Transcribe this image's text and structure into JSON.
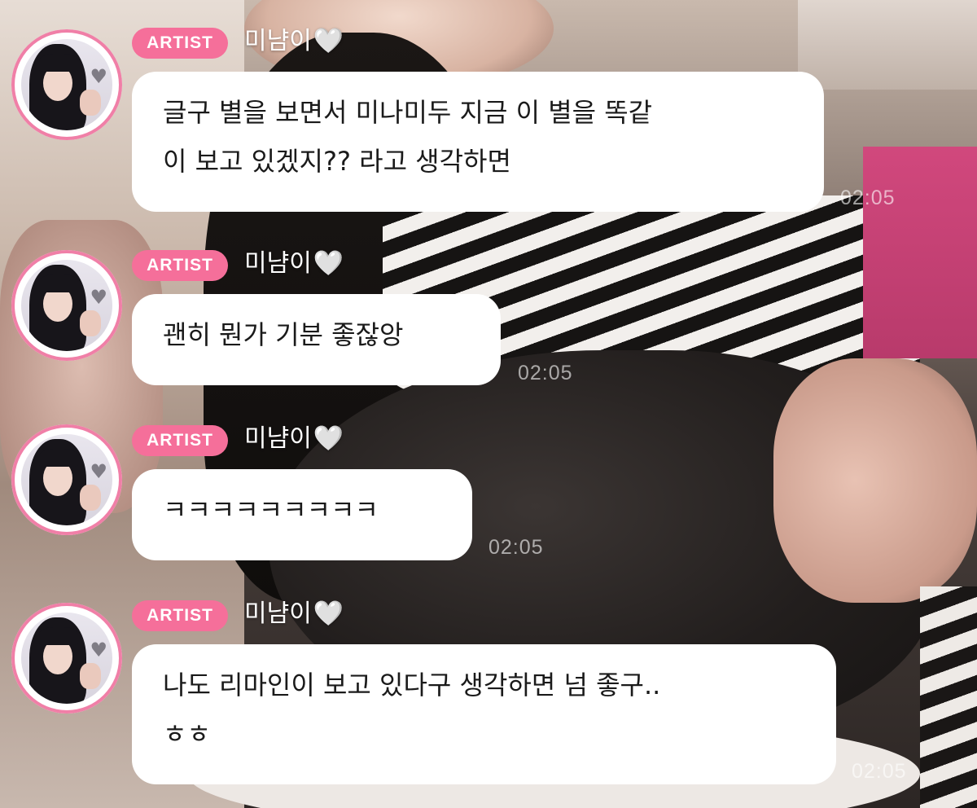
{
  "messages": [
    {
      "badge": "ARTIST",
      "name": "미냠이",
      "heart": "🤍",
      "lines": [
        "글구 별을 보면서 미나미두 지금 이 별을 똑같",
        "이 보고 있겠지?? 라고 생각하면"
      ],
      "time": "02:05"
    },
    {
      "badge": "ARTIST",
      "name": "미냠이",
      "heart": "🤍",
      "lines": [
        "괜히 뭔가 기분 좋잖앙"
      ],
      "time": "02:05"
    },
    {
      "badge": "ARTIST",
      "name": "미냠이",
      "heart": "🤍",
      "lines": [
        "ㅋㅋㅋㅋㅋㅋㅋㅋㅋ"
      ],
      "time": "02:05"
    },
    {
      "badge": "ARTIST",
      "name": "미냠이",
      "heart": "🤍",
      "lines": [
        "나도 리마인이 보고 있다구 생각하면 넘 좋구..",
        "ㅎㅎ"
      ],
      "time": "02:05"
    }
  ],
  "colors": {
    "badge": "#f56f9a",
    "avatar_ring": "#f07fa7",
    "bubble": "#ffffff",
    "text": "#1a1a1a"
  },
  "icons": {
    "avatar_heart": "gray-heart-icon",
    "name_heart": "white-heart-icon"
  }
}
